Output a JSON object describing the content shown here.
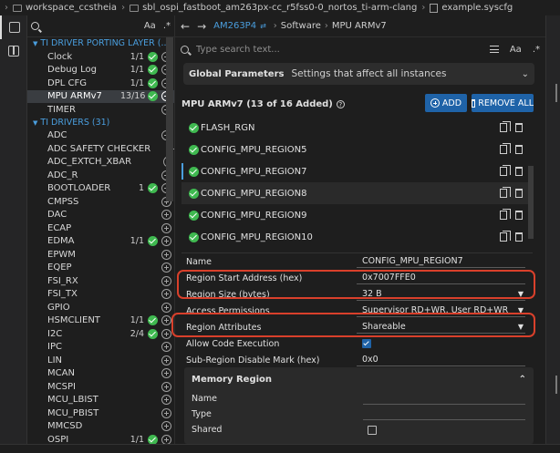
{
  "breadcrumb": {
    "items": [
      "workspace_ccstheia",
      "sbl_ospi_fastboot_am263px-cc_r5fss0-0_nortos_ti-arm-clang",
      "example.syscfg"
    ]
  },
  "left_panel": {
    "search_case_label": "Aa",
    "search_regex_label": ".*",
    "section_porting": "TI DRIVER PORTING LAYER (...",
    "porting_items": [
      {
        "name": "Clock",
        "count": "1/1",
        "ok": true
      },
      {
        "name": "Debug Log",
        "count": "1/1",
        "ok": true
      },
      {
        "name": "DPL CFG",
        "count": "1/1",
        "ok": true
      },
      {
        "name": "MPU ARMv7",
        "count": "13/16",
        "ok": true,
        "selected": true
      },
      {
        "name": "TIMER",
        "count": "",
        "ok": false
      }
    ],
    "section_drivers": "TI DRIVERS (31)",
    "driver_items": [
      {
        "name": "ADC",
        "count": "",
        "ok": false
      },
      {
        "name": "ADC SAFETY CHECKER",
        "count": "",
        "ok": false
      },
      {
        "name": "ADC_EXTCH_XBAR",
        "count": "",
        "ok": false
      },
      {
        "name": "ADC_R",
        "count": "",
        "ok": false
      },
      {
        "name": "BOOTLOADER",
        "count": "1",
        "ok": true
      },
      {
        "name": "CMPSS",
        "count": "",
        "ok": false
      },
      {
        "name": "DAC",
        "count": "",
        "ok": false
      },
      {
        "name": "ECAP",
        "count": "",
        "ok": false
      },
      {
        "name": "EDMA",
        "count": "1/1",
        "ok": true
      },
      {
        "name": "EPWM",
        "count": "",
        "ok": false
      },
      {
        "name": "EQEP",
        "count": "",
        "ok": false
      },
      {
        "name": "FSI_RX",
        "count": "",
        "ok": false
      },
      {
        "name": "FSI_TX",
        "count": "",
        "ok": false
      },
      {
        "name": "GPIO",
        "count": "",
        "ok": false
      },
      {
        "name": "HSMCLIENT",
        "count": "1/1",
        "ok": true
      },
      {
        "name": "I2C",
        "count": "2/4",
        "ok": true
      },
      {
        "name": "IPC",
        "count": "",
        "ok": false
      },
      {
        "name": "LIN",
        "count": "",
        "ok": false
      },
      {
        "name": "MCAN",
        "count": "",
        "ok": false
      },
      {
        "name": "MCSPI",
        "count": "",
        "ok": false
      },
      {
        "name": "MCU_LBIST",
        "count": "",
        "ok": false
      },
      {
        "name": "MCU_PBIST",
        "count": "",
        "ok": false
      },
      {
        "name": "MMCSD",
        "count": "",
        "ok": false
      },
      {
        "name": "OSPI",
        "count": "1/1",
        "ok": true
      }
    ]
  },
  "nav": {
    "device": "AM263P4",
    "crumb_software": "Software",
    "crumb_module": "MPU ARMv7"
  },
  "main_search": {
    "placeholder": "Type search text...",
    "case_label": "Aa",
    "regex_label": ".*"
  },
  "global_params": {
    "title": "Global Parameters",
    "subtitle": "Settings that affect all instances"
  },
  "module": {
    "title": "MPU ARMv7 (13 of 16 Added)",
    "help_glyph": "?",
    "add_label": "ADD",
    "remove_all_label": "REMOVE ALL"
  },
  "instances": [
    {
      "name": "FLASH_RGN"
    },
    {
      "name": "CONFIG_MPU_REGION5"
    },
    {
      "name": "CONFIG_MPU_REGION7",
      "selected": true
    },
    {
      "name": "CONFIG_MPU_REGION8",
      "highlight": true
    },
    {
      "name": "CONFIG_MPU_REGION9"
    },
    {
      "name": "CONFIG_MPU_REGION10"
    }
  ],
  "properties": {
    "name": {
      "label": "Name",
      "value": "CONFIG_MPU_REGION7"
    },
    "start_address": {
      "label": "Region Start Address (hex)",
      "value": "0x7007FFE0"
    },
    "region_size": {
      "label": "Region Size (bytes)",
      "value": "32 B"
    },
    "access": {
      "label": "Access Permissions",
      "value": "Supervisor RD+WR, User RD+WR"
    },
    "attributes": {
      "label": "Region Attributes",
      "value": "Shareable"
    },
    "code_exec": {
      "label": "Allow Code Execution",
      "checked": true
    },
    "subregion": {
      "label": "Sub-Region Disable Mark (hex)",
      "value": "0x0"
    }
  },
  "memory_region": {
    "title": "Memory Region",
    "fields": [
      {
        "label": "Name"
      },
      {
        "label": "Type"
      },
      {
        "label": "Shared",
        "checkbox": true
      }
    ]
  },
  "colors": {
    "accent": "#1f63a8",
    "link": "#4a9ede",
    "ok": "#3fb950",
    "highlight_box": "#d9402b"
  }
}
